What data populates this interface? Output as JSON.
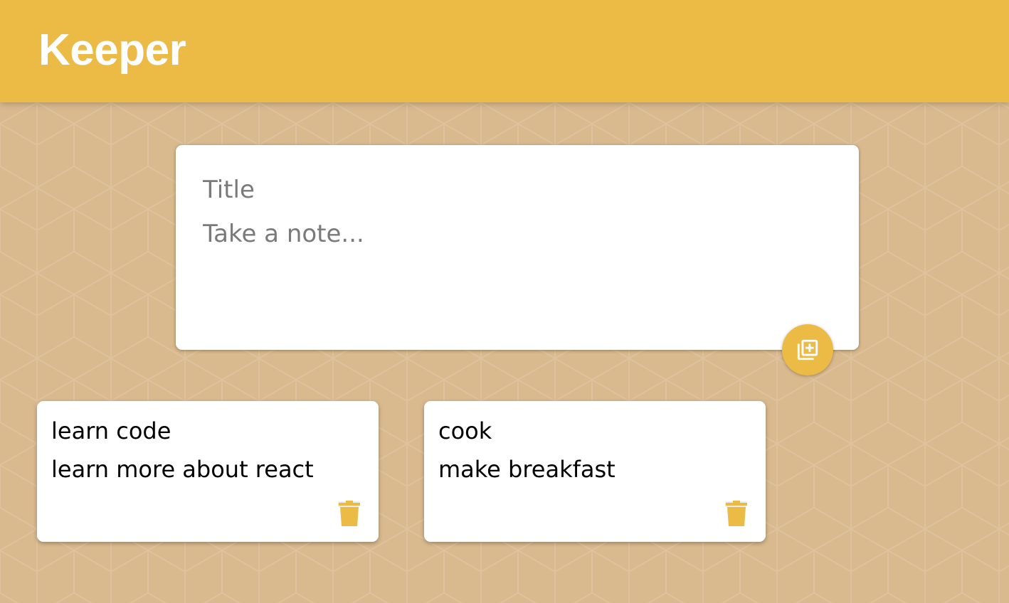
{
  "app": {
    "title": "Keeper"
  },
  "create_area": {
    "title_placeholder": "Title",
    "content_placeholder": "Take a note...",
    "add_icon": "add-note-icon"
  },
  "notes": [
    {
      "title": "learn code",
      "content": "learn more about react",
      "delete_icon": "trash-icon"
    },
    {
      "title": "cook",
      "content": "make breakfast",
      "delete_icon": "trash-icon"
    }
  ],
  "colors": {
    "accent": "#ebbb46",
    "background": "#d9b98e",
    "card": "#ffffff"
  }
}
